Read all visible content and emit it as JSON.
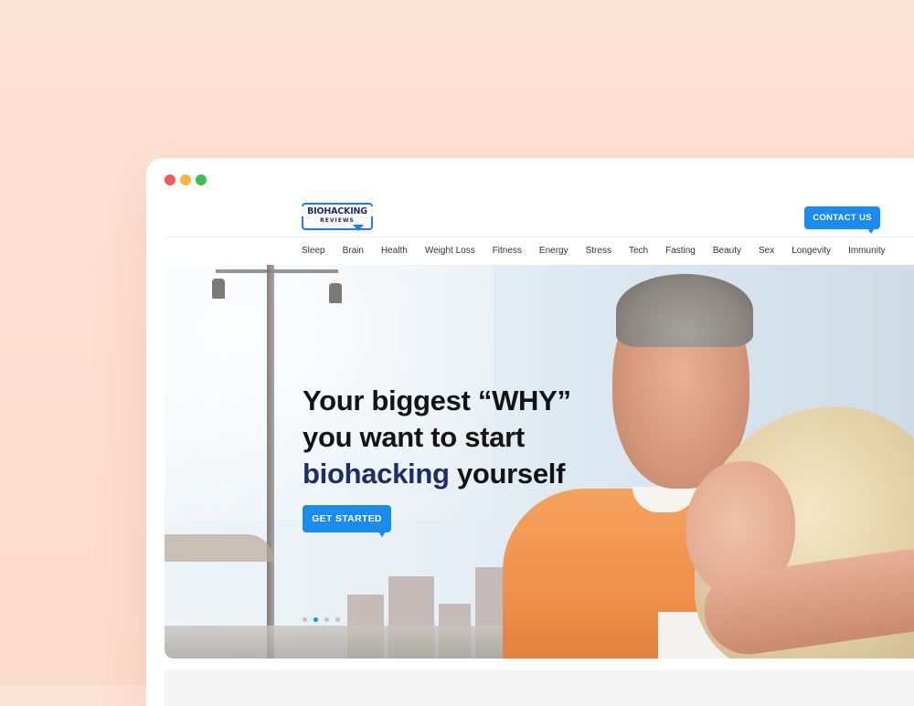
{
  "window": {
    "controls": [
      "close",
      "minimize",
      "maximize"
    ]
  },
  "brand": {
    "name": "BIOHACKING",
    "sub": "REVIEWS",
    "accent_color": "#1a8cf0",
    "navy_color": "#1e2b6d"
  },
  "header": {
    "contact_label": "CONTACT US"
  },
  "nav": {
    "items": [
      "Sleep",
      "Brain",
      "Health",
      "Weight Loss",
      "Fitness",
      "Energy",
      "Stress",
      "Tech",
      "Fasting",
      "Beauty",
      "Sex",
      "Longevity",
      "Immunity"
    ]
  },
  "hero": {
    "line1": "Your biggest “WHY”",
    "line2": "you want to start",
    "line3_accent": "biohacking",
    "line3_rest": " yourself",
    "cta_label": "GET STARTED",
    "slides_total": 4,
    "slide_active": 2
  }
}
